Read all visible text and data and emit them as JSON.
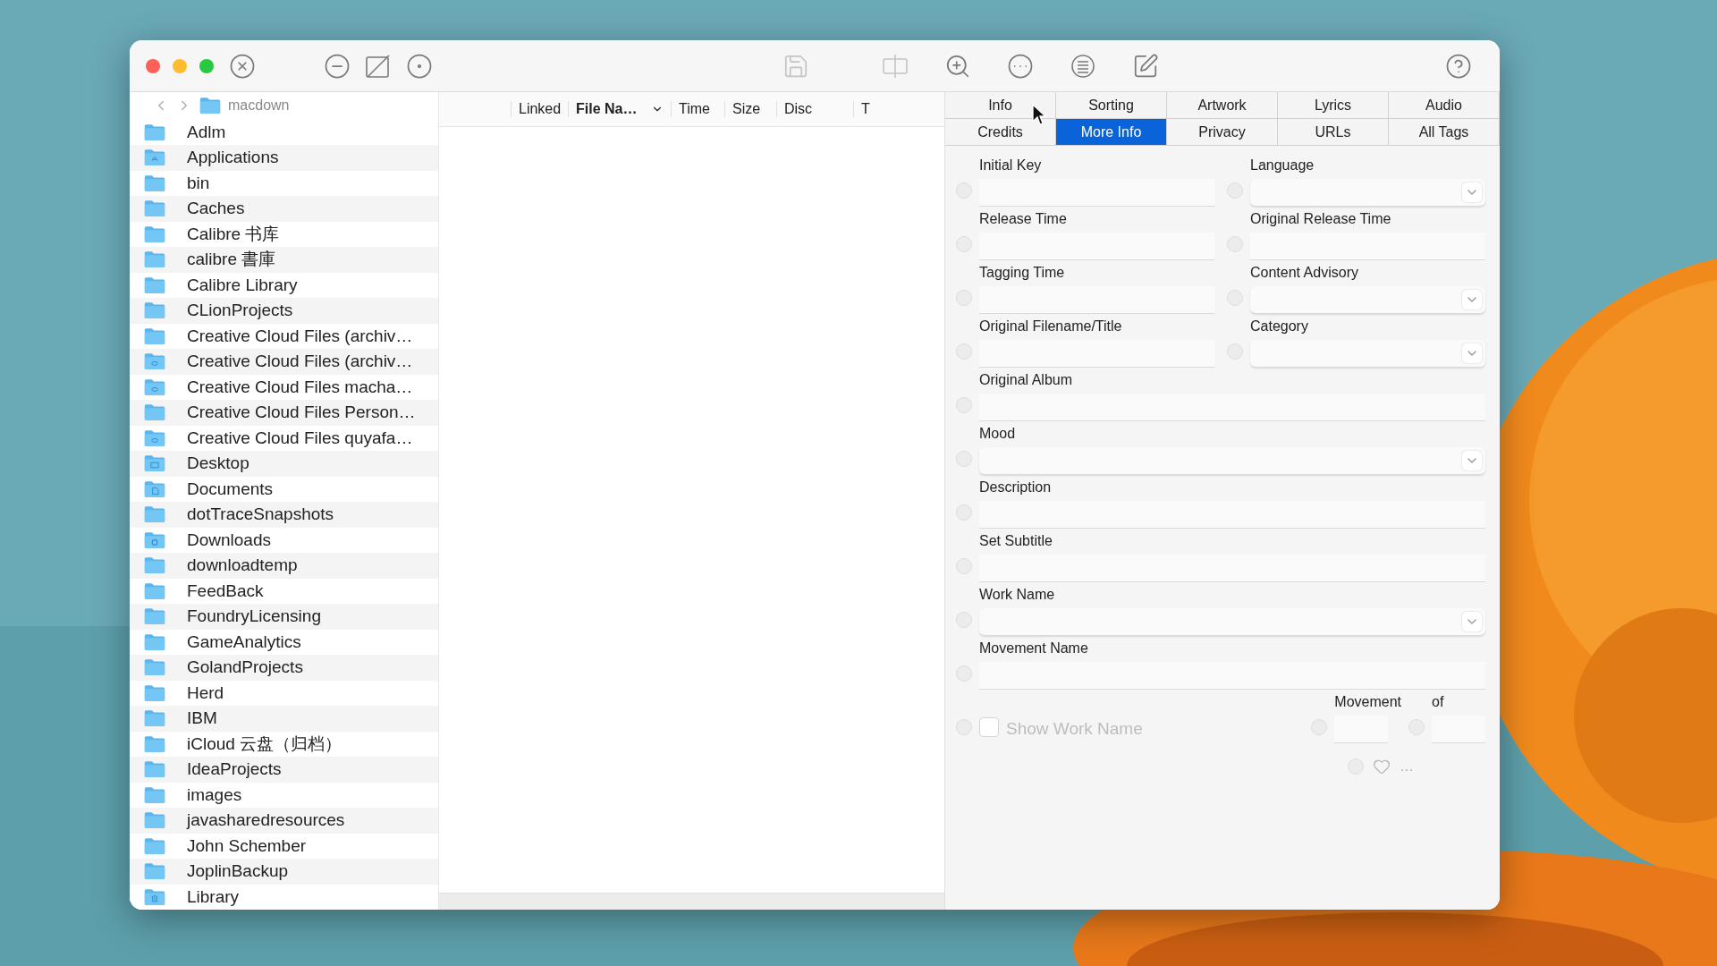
{
  "toolbar": [
    {
      "kind": "close",
      "disabled": false
    },
    {
      "kind": "minus",
      "disabled": false
    },
    {
      "kind": "no-edit",
      "disabled": false
    },
    {
      "kind": "dot",
      "disabled": false
    },
    {
      "kind": "save",
      "disabled": true
    },
    {
      "kind": "split",
      "disabled": true
    },
    {
      "kind": "zoom",
      "disabled": false
    },
    {
      "kind": "more",
      "disabled": false
    },
    {
      "kind": "list",
      "disabled": false
    },
    {
      "kind": "compose",
      "disabled": false
    },
    {
      "kind": "help",
      "disabled": false
    }
  ],
  "sidebar": {
    "path": "macdown",
    "items": [
      {
        "name": "Adlm",
        "kind": "folder"
      },
      {
        "name": "Applications",
        "kind": "applications"
      },
      {
        "name": "bin",
        "kind": "folder"
      },
      {
        "name": "Caches",
        "kind": "folder"
      },
      {
        "name": "Calibre 书库",
        "kind": "folder"
      },
      {
        "name": "calibre 書庫",
        "kind": "folder"
      },
      {
        "name": "Calibre Library",
        "kind": "folder"
      },
      {
        "name": "CLionProjects",
        "kind": "folder"
      },
      {
        "name": "Creative Cloud Files (archiv…",
        "kind": "folder"
      },
      {
        "name": "Creative Cloud Files (archiv…",
        "kind": "cloud"
      },
      {
        "name": "Creative Cloud Files macha…",
        "kind": "cloud"
      },
      {
        "name": "Creative Cloud Files Person…",
        "kind": "folder"
      },
      {
        "name": "Creative Cloud Files quyafa…",
        "kind": "cloud"
      },
      {
        "name": "Desktop",
        "kind": "desktop"
      },
      {
        "name": "Documents",
        "kind": "documents"
      },
      {
        "name": "dotTraceSnapshots",
        "kind": "folder"
      },
      {
        "name": "Downloads",
        "kind": "downloads"
      },
      {
        "name": "downloadtemp",
        "kind": "folder"
      },
      {
        "name": "FeedBack",
        "kind": "folder"
      },
      {
        "name": "FoundryLicensing",
        "kind": "folder"
      },
      {
        "name": "GameAnalytics",
        "kind": "folder"
      },
      {
        "name": "GolandProjects",
        "kind": "folder"
      },
      {
        "name": "Herd",
        "kind": "folder"
      },
      {
        "name": "IBM",
        "kind": "folder"
      },
      {
        "name": "iCloud 云盘（归档）",
        "kind": "folder"
      },
      {
        "name": "IdeaProjects",
        "kind": "folder"
      },
      {
        "name": "images",
        "kind": "folder"
      },
      {
        "name": "javasharedresources",
        "kind": "folder"
      },
      {
        "name": "John Schember",
        "kind": "folder"
      },
      {
        "name": "JoplinBackup",
        "kind": "folder"
      },
      {
        "name": "Library",
        "kind": "library"
      }
    ]
  },
  "file_list": {
    "columns": [
      {
        "label": "Linked",
        "sorted": false
      },
      {
        "label": "File Na…",
        "sorted": true
      },
      {
        "label": "Time",
        "sorted": false
      },
      {
        "label": "Size",
        "sorted": false
      },
      {
        "label": "Disc",
        "sorted": false
      },
      {
        "label": "T",
        "sorted": false
      }
    ]
  },
  "tabs": [
    [
      {
        "label": "Info",
        "selected": false
      },
      {
        "label": "Sorting",
        "selected": false
      },
      {
        "label": "Artwork",
        "selected": false
      },
      {
        "label": "Lyrics",
        "selected": false
      },
      {
        "label": "Audio",
        "selected": false
      }
    ],
    [
      {
        "label": "Credits",
        "selected": false
      },
      {
        "label": "More Info",
        "selected": true
      },
      {
        "label": "Privacy",
        "selected": false
      },
      {
        "label": "URLs",
        "selected": false
      },
      {
        "label": "All Tags",
        "selected": false
      }
    ]
  ],
  "form": {
    "rows": [
      [
        {
          "label": "Initial Key",
          "kind": "text",
          "checked": false
        },
        {
          "label": "Language",
          "kind": "select",
          "checked": false
        }
      ],
      [
        {
          "label": "Release Time",
          "kind": "text",
          "checked": false
        },
        {
          "label": "Original Release Time",
          "kind": "text",
          "checked": false
        }
      ],
      [
        {
          "label": "Tagging Time",
          "kind": "text",
          "checked": false
        },
        {
          "label": "Content Advisory",
          "kind": "select",
          "checked": false
        }
      ],
      [
        {
          "label": "Original Filename/Title",
          "kind": "text",
          "checked": false
        },
        {
          "label": "Category",
          "kind": "select",
          "checked": false
        }
      ],
      [
        {
          "label": "Original Album",
          "kind": "text",
          "checked": false
        }
      ],
      [
        {
          "label": "Mood",
          "kind": "select",
          "checked": false
        }
      ],
      [
        {
          "label": "Description",
          "kind": "text",
          "checked": false
        }
      ],
      [
        {
          "label": "Set Subtitle",
          "kind": "text",
          "checked": false
        }
      ],
      [
        {
          "label": "Work Name",
          "kind": "select",
          "checked": false
        }
      ],
      [
        {
          "label": "Movement Name",
          "kind": "text",
          "checked": false
        }
      ]
    ],
    "show_work_name": {
      "label": "Show Work Name",
      "checked": false,
      "dot_checked": false
    },
    "movement": {
      "label": "Movement",
      "checked": false,
      "of_label": "of",
      "of_checked": false
    },
    "rating": {
      "text": "…",
      "checked": false
    }
  }
}
